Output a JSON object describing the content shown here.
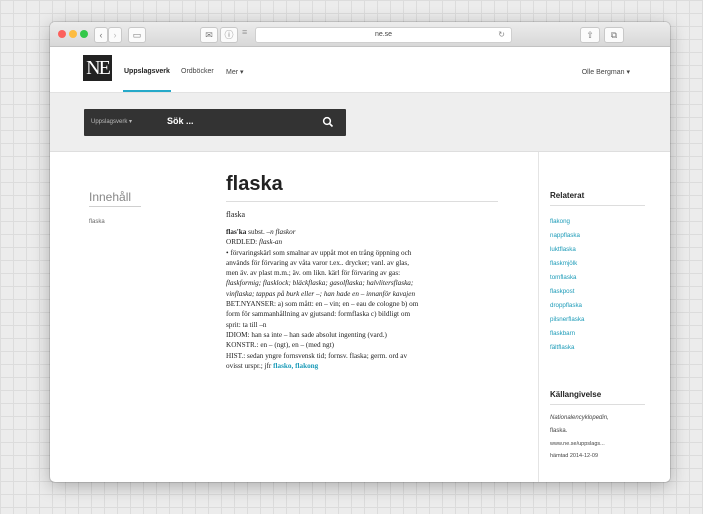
{
  "browser": {
    "url": "ne.se",
    "back_glyph": "‹",
    "forward_glyph": "›",
    "reload_glyph": "↻",
    "sidebar_glyph": "▭",
    "share_glyph": "⇧",
    "tabs_glyph": "⧉",
    "reader_glyph": "≡",
    "mail_glyph": "✉",
    "info_glyph": "ⓘ"
  },
  "header": {
    "logo": "NE",
    "nav": [
      {
        "label": "Uppslagsverk",
        "active": true
      },
      {
        "label": "Ordböcker",
        "active": false
      },
      {
        "label": "Mer ▾",
        "active": false
      }
    ],
    "user": "Olle Bergman ▾"
  },
  "search": {
    "category": "Uppslagsverk ▾",
    "placeholder": "Sök ..."
  },
  "toc": {
    "title": "Innehåll",
    "items": [
      "flaska"
    ]
  },
  "article": {
    "headword": "flaska",
    "lemma": "flaska",
    "entry_head": "flas'ka",
    "entry_pos": " subst. –",
    "entry_forms": "n flaskor",
    "ordled_label": "ORDLED: ",
    "ordled": "flask-an",
    "definition_line1": "• förvaringskärl som smalnar av uppåt mot en trång öppning och",
    "definition_line2": "används för förvaring av våta varor t.ex.. drycker; vanl. av glas,",
    "definition_line3": "men äv. av plast m.m.; äv. om likn. kärl för förvaring av gas:",
    "examples_line1": "flaskformig; flasklock; bläckflaska; gasolflaska; halvlitersflaska;",
    "examples_line2": "vinflaska; tappas på burk eller –; han hade en – innanför kavajen",
    "nyanser_line": "BET.NYANSER: a) som mått: en – vin; en – eau de cologne b) om",
    "nyanser_line2": "form för sammanhållning av gjutsand: formflaska c) bildligt om",
    "nyanser_line3": "sprit: ta till –n",
    "idiom_line": "IDIOM: han sa inte – han sade absolut ingenting (vard.)",
    "konstr_line": "KONSTR.: en – (ngt), en – (med ngt)",
    "hist_line1": "HIST.: sedan yngre fornsvensk tid; fornsv. flaska; germ. ord av",
    "hist_line2_text": "ovisst urspr.; jfr ",
    "hist_link1": "flasko",
    "hist_link_sep": ", ",
    "hist_link2": "flakong"
  },
  "sidebar": {
    "related_title": "Relaterat",
    "related": [
      "flakong",
      "nappflaska",
      "luktflaska",
      "flaskmjölk",
      "tomflaska",
      "flaskpost",
      "droppflaska",
      "pilsnerflaska",
      "flaskbarn",
      "fältflaska"
    ],
    "source_title": "Källangivelse",
    "source_line1": "Nationalencyklopedin,",
    "source_line2": "flaska.",
    "source_line3": "www.ne.se/uppslags...",
    "source_line4": "hämtad 2014-12-09"
  }
}
